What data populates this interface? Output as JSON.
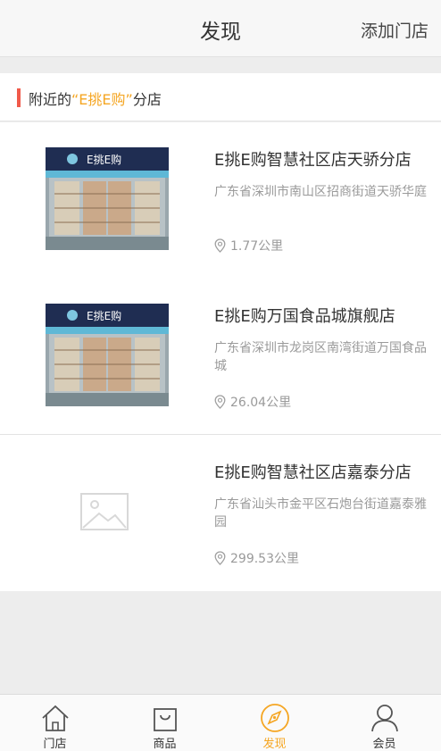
{
  "header": {
    "title": "发现",
    "action": "添加门店"
  },
  "section": {
    "prefix": "附近的",
    "brand": "“E挑E购”",
    "suffix": "分店"
  },
  "stores": [
    {
      "name": "E挑E购智慧社区店天骄分店",
      "address": "广东省深圳市南山区招商街道天骄华庭",
      "distance": "1.77公里",
      "image": "storefront",
      "sign": "E挑E购"
    },
    {
      "name": "E挑E购万国食品城旗舰店",
      "address": "广东省深圳市龙岗区南湾街道万国食品城",
      "distance": "26.04公里",
      "image": "storefront",
      "sign": "E挑E购"
    },
    {
      "name": "E挑E购智慧社区店嘉泰分店",
      "address": "广东省汕头市金平区石炮台街道嘉泰雅园",
      "distance": "299.53公里",
      "image": "placeholder"
    }
  ],
  "tabs": [
    {
      "label": "门店",
      "icon": "home-icon"
    },
    {
      "label": "商品",
      "icon": "shopping-bag-icon"
    },
    {
      "label": "发现",
      "icon": "compass-icon",
      "active": true
    },
    {
      "label": "会员",
      "icon": "user-icon"
    }
  ],
  "colors": {
    "accent": "#f5a623",
    "marker": "#f15a4a"
  }
}
